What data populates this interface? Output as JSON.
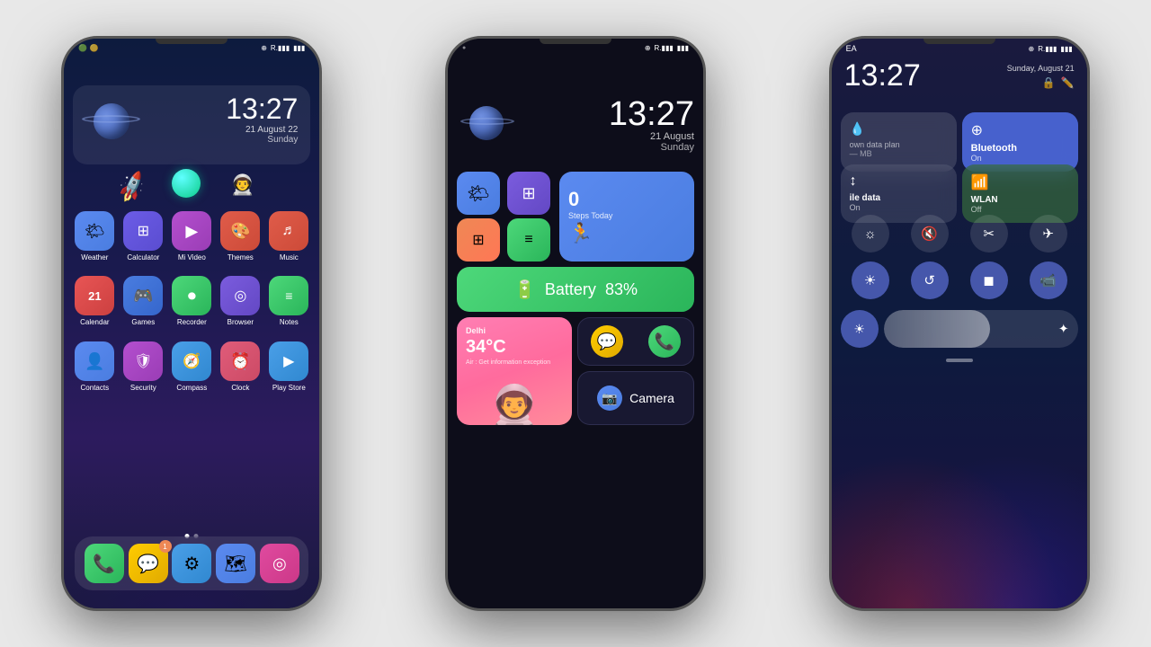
{
  "phone1": {
    "statusBar": {
      "left": "",
      "bluetooth": "⊕",
      "signal": "R.ill",
      "battery": "▮▮▮"
    },
    "clock": {
      "time": "13:27",
      "date": "21 August 22",
      "day": "Sunday"
    },
    "apps": [
      {
        "name": "Weather",
        "label": "Weather",
        "color": "#5b8af0",
        "icon": "🌤️",
        "row": 1
      },
      {
        "name": "Calculator",
        "label": "Calculator",
        "color": "#6c5ce7",
        "icon": "⊞",
        "row": 1
      },
      {
        "name": "Mi Video",
        "label": "Mi Video",
        "color": "#b44fcf",
        "icon": "▶",
        "row": 1
      },
      {
        "name": "Themes",
        "label": "Themes",
        "color": "#e05c4a",
        "icon": "◉",
        "row": 1
      },
      {
        "name": "Music",
        "label": "Music",
        "color": "#e05c4a",
        "icon": "♬",
        "row": 1
      },
      {
        "name": "Calendar",
        "label": "Calendar",
        "color": "#e85555",
        "icon": "21",
        "row": 2
      },
      {
        "name": "Games",
        "label": "Games",
        "color": "#4a7de0",
        "icon": "🎮",
        "row": 2
      },
      {
        "name": "Recorder",
        "label": "Recorder",
        "color": "#4dd87a",
        "icon": "●",
        "row": 2
      },
      {
        "name": "Browser",
        "label": "Browser",
        "color": "#7b5cde",
        "icon": "◎",
        "row": 2
      },
      {
        "name": "Notes",
        "label": "Notes",
        "color": "#4dd87a",
        "icon": "≡",
        "row": 2
      },
      {
        "name": "Contacts",
        "label": "Contacts",
        "color": "#5b8af0",
        "icon": "👤",
        "row": 3
      },
      {
        "name": "Security",
        "label": "Security",
        "color": "#b44fcf",
        "icon": "🔒",
        "row": 3
      },
      {
        "name": "Compass",
        "label": "Compass",
        "color": "#4a9fe8",
        "icon": "◎",
        "row": 3
      },
      {
        "name": "Clock",
        "label": "Clock",
        "color": "#e05c7a",
        "icon": "⊕",
        "row": 3
      },
      {
        "name": "Play Store",
        "label": "Play Store",
        "color": "#4a9fe8",
        "icon": "▶",
        "row": 3
      }
    ],
    "dock": [
      {
        "name": "Phone",
        "icon": "📞",
        "color": "#4dd87a"
      },
      {
        "name": "Messages",
        "icon": "💬",
        "color": "#ffcc00"
      },
      {
        "name": "Settings",
        "icon": "⚙",
        "color": "#4a9fe8"
      },
      {
        "name": "Maps",
        "icon": "🗺",
        "color": "#5b8af0"
      },
      {
        "name": "Browser2",
        "icon": "◎",
        "color": "#e04a9f"
      }
    ]
  },
  "phone2": {
    "clock": {
      "time": "13:27",
      "date": "21 August",
      "day": "Sunday"
    },
    "widgets": {
      "steps": {
        "count": "0",
        "label": "Steps Today"
      },
      "battery": {
        "label": "Battery",
        "percent": "83%"
      },
      "weather": {
        "city": "Delhi",
        "temp": "34°C",
        "desc": "Air : Get information exception"
      },
      "camera": {
        "label": "Camera"
      }
    }
  },
  "phone3": {
    "statusBar": {
      "left": "EA",
      "right": "⊕ R.ill ▮"
    },
    "clock": {
      "time": "13:27",
      "date": "Sunday, August 21"
    },
    "tiles": {
      "data": {
        "label": "own data plan",
        "sub": "— MB"
      },
      "bluetooth": {
        "label": "Bluetooth",
        "state": "On"
      },
      "mobile": {
        "label": "ile data",
        "state": "On"
      },
      "wlan": {
        "label": "WLAN",
        "state": "Off"
      }
    },
    "controls": [
      {
        "name": "brightness-down",
        "icon": "☼"
      },
      {
        "name": "mute",
        "icon": "🔇"
      },
      {
        "name": "scissors",
        "icon": "✂"
      },
      {
        "name": "airplane",
        "icon": "✈"
      }
    ],
    "controls2": [
      {
        "name": "brightness-up",
        "icon": "☀"
      },
      {
        "name": "auto-rotate",
        "icon": "⟳"
      },
      {
        "name": "flashlight",
        "icon": "⬛"
      },
      {
        "name": "video",
        "icon": "📹"
      }
    ]
  }
}
